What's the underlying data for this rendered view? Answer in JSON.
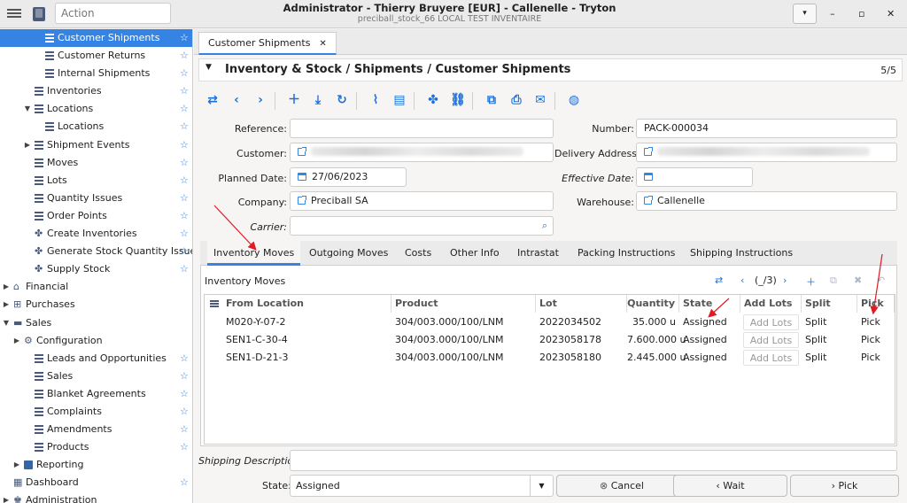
{
  "window": {
    "title": "Administrator - Thierry Bruyere [EUR] - Callenelle - Tryton",
    "subtitle": "preciball_stock_66 LOCAL TEST INVENTAIRE",
    "action_placeholder": "Action",
    "dropdown_glyph": "▾",
    "minimize": "–",
    "maximize": "▫",
    "close": "✕"
  },
  "sidebar": {
    "items": [
      {
        "label": "Customer Shipments",
        "indent": 3,
        "icon": "list-icon",
        "star": true,
        "selected": true,
        "arrow": ""
      },
      {
        "label": "Customer Returns",
        "indent": 3,
        "icon": "list-icon",
        "star": true,
        "selected": false,
        "arrow": ""
      },
      {
        "label": "Internal Shipments",
        "indent": 3,
        "icon": "list-icon",
        "star": true,
        "selected": false,
        "arrow": ""
      },
      {
        "label": "Inventories",
        "indent": 2,
        "icon": "list-icon",
        "star": true,
        "selected": false,
        "arrow": ""
      },
      {
        "label": "Locations",
        "indent": 2,
        "icon": "list-icon",
        "star": true,
        "selected": false,
        "arrow": "▼"
      },
      {
        "label": "Locations",
        "indent": 3,
        "icon": "list-icon",
        "star": true,
        "selected": false,
        "arrow": ""
      },
      {
        "label": "Shipment Events",
        "indent": 2,
        "icon": "list-icon",
        "star": true,
        "selected": false,
        "arrow": "▶"
      },
      {
        "label": "Moves",
        "indent": 2,
        "icon": "list-icon",
        "star": true,
        "selected": false,
        "arrow": ""
      },
      {
        "label": "Lots",
        "indent": 2,
        "icon": "list-icon",
        "star": true,
        "selected": false,
        "arrow": ""
      },
      {
        "label": "Quantity Issues",
        "indent": 2,
        "icon": "list-icon",
        "star": true,
        "selected": false,
        "arrow": ""
      },
      {
        "label": "Order Points",
        "indent": 2,
        "icon": "list-icon",
        "star": true,
        "selected": false,
        "arrow": ""
      },
      {
        "label": "Create Inventories",
        "indent": 2,
        "icon": "wizard-icon",
        "star": true,
        "selected": false,
        "arrow": ""
      },
      {
        "label": "Generate Stock Quantity Issues",
        "indent": 2,
        "icon": "wizard-icon",
        "star": true,
        "selected": false,
        "arrow": ""
      },
      {
        "label": "Supply Stock",
        "indent": 2,
        "icon": "wizard-icon",
        "star": true,
        "selected": false,
        "arrow": ""
      },
      {
        "label": "Financial",
        "indent": 0,
        "icon": "bank-icon",
        "star": false,
        "selected": false,
        "arrow": "▶"
      },
      {
        "label": "Purchases",
        "indent": 0,
        "icon": "cart-icon",
        "star": false,
        "selected": false,
        "arrow": "▶"
      },
      {
        "label": "Sales",
        "indent": 0,
        "icon": "register-icon",
        "star": false,
        "selected": false,
        "arrow": "▼"
      },
      {
        "label": "Configuration",
        "indent": 1,
        "icon": "gear-icon",
        "star": false,
        "selected": false,
        "arrow": "▶"
      },
      {
        "label": "Leads and Opportunities",
        "indent": 2,
        "icon": "list-icon",
        "star": true,
        "selected": false,
        "arrow": ""
      },
      {
        "label": "Sales",
        "indent": 2,
        "icon": "list-icon",
        "star": true,
        "selected": false,
        "arrow": ""
      },
      {
        "label": "Blanket Agreements",
        "indent": 2,
        "icon": "list-icon",
        "star": true,
        "selected": false,
        "arrow": ""
      },
      {
        "label": "Complaints",
        "indent": 2,
        "icon": "list-icon",
        "star": true,
        "selected": false,
        "arrow": ""
      },
      {
        "label": "Amendments",
        "indent": 2,
        "icon": "list-icon",
        "star": true,
        "selected": false,
        "arrow": ""
      },
      {
        "label": "Products",
        "indent": 2,
        "icon": "list-icon",
        "star": true,
        "selected": false,
        "arrow": ""
      },
      {
        "label": "Reporting",
        "indent": 1,
        "icon": "folder-icon",
        "star": false,
        "selected": false,
        "arrow": "▶"
      },
      {
        "label": "Dashboard",
        "indent": 0,
        "icon": "dashboard-icon",
        "star": true,
        "selected": false,
        "arrow": ""
      },
      {
        "label": "Administration",
        "indent": 0,
        "icon": "admin-icon",
        "star": false,
        "selected": false,
        "arrow": "▶"
      }
    ]
  },
  "tab": {
    "label": "Customer Shipments",
    "close": "✕"
  },
  "breadcrumb": {
    "title": "Inventory & Stock / Shipments / Customer Shipments",
    "count": "5/5",
    "arrow": "▼"
  },
  "toolbar": {
    "icons": [
      "switch-view-icon",
      "previous-icon",
      "next-icon",
      "new-icon",
      "save-icon",
      "reload-icon",
      "attachment-icon",
      "note-icon",
      "action-icon",
      "relate-icon",
      "open-icon",
      "print-icon",
      "email-icon",
      "web-icon"
    ],
    "glyphs": [
      "⇄",
      "‹",
      "›",
      "＋",
      "⤓",
      "↻",
      "⌇",
      "▤",
      "✤",
      "⛓",
      "⧉",
      "⎙",
      "✉",
      "◍"
    ]
  },
  "form": {
    "reference_label": "Reference:",
    "reference_value": "",
    "number_label": "Number:",
    "number_value": "PACK-000034",
    "customer_label": "Customer:",
    "delivery_label": "Delivery Address:",
    "planned_label": "Planned Date:",
    "planned_value": "27/06/2023",
    "effective_label": "Effective Date:",
    "effective_value": "",
    "company_label": "Company:",
    "company_value": "Preciball SA",
    "warehouse_label": "Warehouse:",
    "warehouse_value": "Callenelle",
    "carrier_label": "Carrier:",
    "carrier_value": ""
  },
  "notebook": {
    "tabs": [
      "Inventory Moves",
      "Outgoing Moves",
      "Costs",
      "Other Info",
      "Intrastat",
      "Packing Instructions",
      "Shipping Instructions"
    ]
  },
  "grid": {
    "title": "Inventory Moves",
    "pager": "(_/3)",
    "columns": [
      "From Location",
      "Product",
      "Lot",
      "Quantity",
      "State",
      "Add Lots",
      "Split",
      "Pick"
    ],
    "rows": [
      {
        "from": "M020-Y-07-2",
        "product": "304/003.000/100/LNM",
        "lot": "2022034502",
        "qty": "35.000 u",
        "state": "Assigned",
        "add_lots": "Add Lots",
        "split": "Split",
        "pick": "Pick"
      },
      {
        "from": "SEN1-C-30-4",
        "product": "304/003.000/100/LNM",
        "lot": "2023058178",
        "qty": "7.600.000 u",
        "state": "Assigned",
        "add_lots": "Add Lots",
        "split": "Split",
        "pick": "Pick"
      },
      {
        "from": "SEN1-D-21-3",
        "product": "304/003.000/100/LNM",
        "lot": "2023058180",
        "qty": "2.445.000 u",
        "state": "Assigned",
        "add_lots": "Add Lots",
        "split": "Split",
        "pick": "Pick"
      }
    ]
  },
  "footer": {
    "shipping_label": "Shipping Description:",
    "state_label": "State:",
    "state_value": "Assigned",
    "cancel": "Cancel",
    "wait": "Wait",
    "pick": "Pick"
  },
  "colors": {
    "accent": "#3584e4",
    "annotation": "#e01b24"
  }
}
